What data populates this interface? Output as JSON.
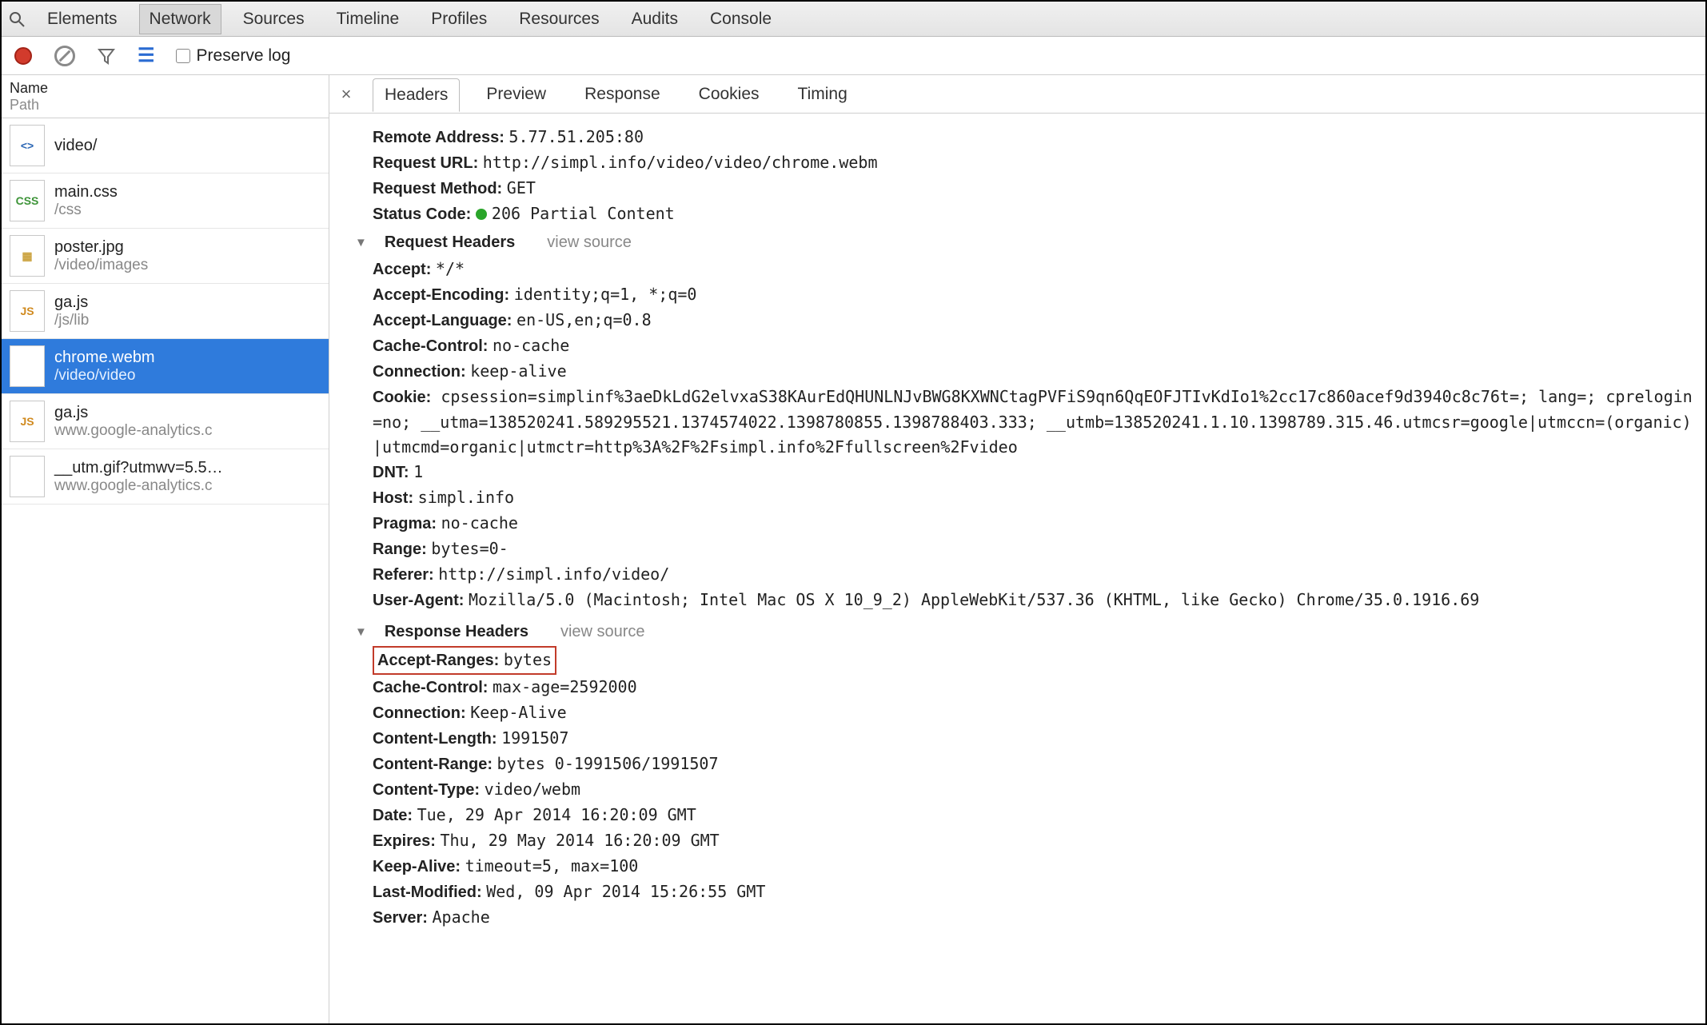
{
  "top_tabs": {
    "items": [
      "Elements",
      "Network",
      "Sources",
      "Timeline",
      "Profiles",
      "Resources",
      "Audits",
      "Console"
    ],
    "active_index": 1
  },
  "toolbar": {
    "preserve_label": "Preserve log",
    "preserve_checked": false
  },
  "left": {
    "header_name": "Name",
    "header_path": "Path",
    "requests": [
      {
        "icon": "html",
        "name": "video/",
        "path": ""
      },
      {
        "icon": "css",
        "name": "main.css",
        "path": "/css"
      },
      {
        "icon": "img",
        "name": "poster.jpg",
        "path": "/video/images"
      },
      {
        "icon": "js",
        "name": "ga.js",
        "path": "/js/lib"
      },
      {
        "icon": "blank",
        "name": "chrome.webm",
        "path": "/video/video"
      },
      {
        "icon": "js",
        "name": "ga.js",
        "path": "www.google-analytics.c"
      },
      {
        "icon": "blank",
        "name": "__utm.gif?utmwv=5.5…",
        "path": "www.google-analytics.c"
      }
    ],
    "selected_index": 4
  },
  "detail_tabs": {
    "items": [
      "Headers",
      "Preview",
      "Response",
      "Cookies",
      "Timing"
    ],
    "active_index": 0
  },
  "details": {
    "general": {
      "remote_address_k": "Remote Address:",
      "remote_address_v": "5.77.51.205:80",
      "request_url_k": "Request URL:",
      "request_url_v": "http://simpl.info/video/video/chrome.webm",
      "request_method_k": "Request Method:",
      "request_method_v": "GET",
      "status_code_k": "Status Code:",
      "status_code_v": "206 Partial Content"
    },
    "request_headers": {
      "title": "Request Headers",
      "view_source": "view source",
      "items": [
        {
          "k": "Accept:",
          "v": "*/*"
        },
        {
          "k": "Accept-Encoding:",
          "v": "identity;q=1, *;q=0"
        },
        {
          "k": "Accept-Language:",
          "v": "en-US,en;q=0.8"
        },
        {
          "k": "Cache-Control:",
          "v": "no-cache"
        },
        {
          "k": "Connection:",
          "v": "keep-alive"
        }
      ],
      "cookie_k": "Cookie:",
      "cookie_v": "cpsession=simplinf%3aeDkLdG2elvxaS38KAurEdQHUNLNJvBWG8KXWNCtagPVFiS9qn6QqEOFJTIvKdIo1%2cc17c860acef9d3940c8c76t=; lang=; cprelogin=no; __utma=138520241.589295521.1374574022.1398780855.1398788403.333; __utmb=138520241.1.10.1398789.315.46.utmcsr=google|utmccn=(organic)|utmcmd=organic|utmctr=http%3A%2F%2Fsimpl.info%2Ffullscreen%2Fvideo",
      "rest": [
        {
          "k": "DNT:",
          "v": "1"
        },
        {
          "k": "Host:",
          "v": "simpl.info"
        },
        {
          "k": "Pragma:",
          "v": "no-cache"
        },
        {
          "k": "Range:",
          "v": "bytes=0-"
        },
        {
          "k": "Referer:",
          "v": "http://simpl.info/video/"
        },
        {
          "k": "User-Agent:",
          "v": "Mozilla/5.0 (Macintosh; Intel Mac OS X 10_9_2) AppleWebKit/537.36 (KHTML, like Gecko) Chrome/35.0.1916.69"
        }
      ]
    },
    "response_headers": {
      "title": "Response Headers",
      "view_source": "view source",
      "items": [
        {
          "k": "Accept-Ranges:",
          "v": "bytes",
          "highlight": true
        },
        {
          "k": "Cache-Control:",
          "v": "max-age=2592000"
        },
        {
          "k": "Connection:",
          "v": "Keep-Alive"
        },
        {
          "k": "Content-Length:",
          "v": "1991507"
        },
        {
          "k": "Content-Range:",
          "v": "bytes 0-1991506/1991507"
        },
        {
          "k": "Content-Type:",
          "v": "video/webm"
        },
        {
          "k": "Date:",
          "v": "Tue, 29 Apr 2014 16:20:09 GMT"
        },
        {
          "k": "Expires:",
          "v": "Thu, 29 May 2014 16:20:09 GMT"
        },
        {
          "k": "Keep-Alive:",
          "v": "timeout=5, max=100"
        },
        {
          "k": "Last-Modified:",
          "v": "Wed, 09 Apr 2014 15:26:55 GMT"
        },
        {
          "k": "Server:",
          "v": "Apache"
        }
      ]
    }
  }
}
